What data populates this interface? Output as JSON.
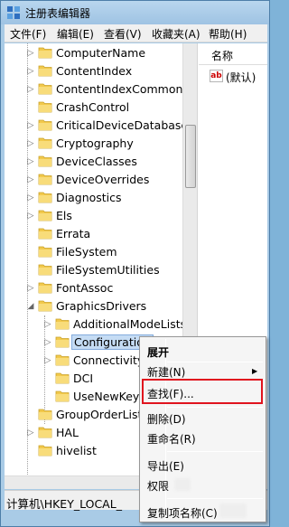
{
  "window": {
    "title": "注册表编辑器"
  },
  "menu": [
    "文件(F)",
    "编辑(E)",
    "查看(V)",
    "收藏夹(A)",
    "帮助(H)"
  ],
  "tree": {
    "rows": [
      {
        "label": "ComputerName",
        "expander": "▷"
      },
      {
        "label": "ContentIndex",
        "expander": "▷"
      },
      {
        "label": "ContentIndexCommon",
        "expander": "▷"
      },
      {
        "label": "CrashControl",
        "expander": ""
      },
      {
        "label": "CriticalDeviceDatabase",
        "expander": "▷"
      },
      {
        "label": "Cryptography",
        "expander": "▷"
      },
      {
        "label": "DeviceClasses",
        "expander": "▷"
      },
      {
        "label": "DeviceOverrides",
        "expander": "▷"
      },
      {
        "label": "Diagnostics",
        "expander": "▷"
      },
      {
        "label": "Els",
        "expander": "▷"
      },
      {
        "label": "Errata",
        "expander": ""
      },
      {
        "label": "FileSystem",
        "expander": ""
      },
      {
        "label": "FileSystemUtilities",
        "expander": ""
      },
      {
        "label": "FontAssoc",
        "expander": "▷"
      },
      {
        "label": "GraphicsDrivers",
        "expander": "◢"
      },
      {
        "label": "AdditionalModeLists",
        "expander": "▷"
      },
      {
        "label": "Configuration",
        "expander": "▷"
      },
      {
        "label": "Connectivity",
        "expander": "▷"
      },
      {
        "label": "DCI",
        "expander": ""
      },
      {
        "label": "UseNewKey",
        "expander": ""
      },
      {
        "label": "GroupOrderList",
        "expander": ""
      },
      {
        "label": "HAL",
        "expander": "▷"
      },
      {
        "label": "hivelist",
        "expander": ""
      }
    ]
  },
  "list": {
    "column_name": "名称",
    "value_icon": "ab",
    "value_name": "(默认)"
  },
  "statusbar": {
    "path": "计算机\\HKEY_LOCAL_"
  },
  "context_menu": {
    "expand": "展开",
    "new": "新建(N)",
    "find": "查找(F)...",
    "delete": "删除(D)",
    "rename": "重命名(R)",
    "export": "导出(E)",
    "permissions": "权限",
    "copy_key_name": "复制项名称(C)",
    "highlight_color": "#e0141e"
  },
  "colors": {
    "folder": "#f2c94c",
    "selection": "#c5dcf4"
  }
}
